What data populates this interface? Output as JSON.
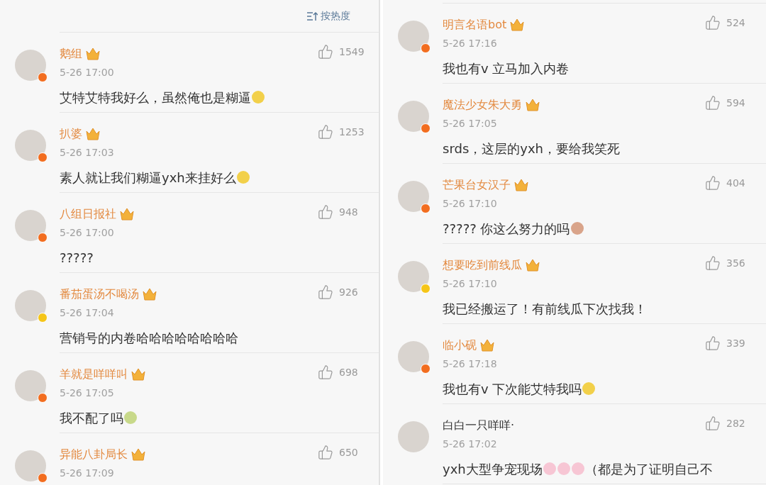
{
  "sort_button": {
    "label": "按热度"
  },
  "left_comments": [
    {
      "name": "鹅组",
      "vip": true,
      "color": "#f26d1f",
      "time": "5-26 17:00",
      "likes": "1549",
      "body": [
        {
          "kind": "text",
          "text": "艾特艾特我好么，虽然俺也是糊逼"
        },
        {
          "kind": "emoji",
          "color": "#f2d04a"
        }
      ]
    },
    {
      "name": "扒婆",
      "vip": true,
      "color": "#f26d1f",
      "time": "5-26 17:03",
      "likes": "1253",
      "body": [
        {
          "kind": "text",
          "text": "素人就让我们糊逼yxh来挂好么"
        },
        {
          "kind": "emoji",
          "color": "#f2d04a"
        }
      ]
    },
    {
      "name": "八组日报社",
      "vip": true,
      "color": "#f26d1f",
      "time": "5-26 17:00",
      "likes": "948",
      "body": [
        {
          "kind": "text",
          "text": "?????"
        }
      ]
    },
    {
      "name": "番茄蛋汤不喝汤",
      "vip": true,
      "color": "#f5c518",
      "time": "5-26 17:04",
      "likes": "926",
      "body": [
        {
          "kind": "text",
          "text": "营销号的内卷哈哈哈哈哈哈哈哈"
        }
      ]
    },
    {
      "name": "羊就是咩咩叫",
      "vip": true,
      "color": "#f26d1f",
      "time": "5-26 17:05",
      "likes": "698",
      "body": [
        {
          "kind": "text",
          "text": "我不配了吗"
        },
        {
          "kind": "emoji",
          "color": "#c8d98a"
        }
      ]
    },
    {
      "name": "异能八卦局长",
      "vip": true,
      "color": "#f26d1f",
      "time": "5-26 17:09",
      "likes": "650"
    }
  ],
  "right_comments": [
    {
      "name": "明言名语bot",
      "vip": true,
      "color": "#f26d1f",
      "time": "5-26 17:16",
      "likes": "524",
      "body": [
        {
          "kind": "text",
          "text": "我也有v 立马加入内卷"
        }
      ]
    },
    {
      "name": "魔法少女朱大勇",
      "vip": true,
      "color": "#f26d1f",
      "time": "5-26 17:05",
      "likes": "594",
      "body": [
        {
          "kind": "text",
          "text": "srds，这层的yxh，要给我笑死"
        }
      ]
    },
    {
      "name": "芒果台女汉子",
      "vip": true,
      "color": "#f26d1f",
      "time": "5-26 17:10",
      "likes": "404",
      "body": [
        {
          "kind": "text",
          "text": "????? 你这么努力的吗"
        },
        {
          "kind": "emoji",
          "color": "#d9a48a"
        }
      ]
    },
    {
      "name": "想要吃到前线瓜",
      "vip": true,
      "color": "#f5c518",
      "time": "5-26 17:10",
      "likes": "356",
      "body": [
        {
          "kind": "text",
          "text": "我已经搬运了！有前线瓜下次找我！"
        }
      ]
    },
    {
      "name": "临小砚",
      "vip": true,
      "color": "#f26d1f",
      "time": "5-26 17:18",
      "likes": "339",
      "body": [
        {
          "kind": "text",
          "text": "我也有v 下次能艾特我吗"
        },
        {
          "kind": "emoji",
          "color": "#f2d04a"
        }
      ]
    },
    {
      "name": "白白一只咩咩·",
      "vip": false,
      "time": "5-26 17:02",
      "likes": "282",
      "body": [
        {
          "kind": "text",
          "text": "yxh大型争宠现场"
        },
        {
          "kind": "emoji",
          "color": "#f7c6d4"
        },
        {
          "kind": "emoji",
          "color": "#f7c6d4"
        },
        {
          "kind": "emoji",
          "color": "#f7c6d4"
        },
        {
          "kind": "text",
          "text": "（都是为了证明自己不"
        }
      ]
    }
  ]
}
